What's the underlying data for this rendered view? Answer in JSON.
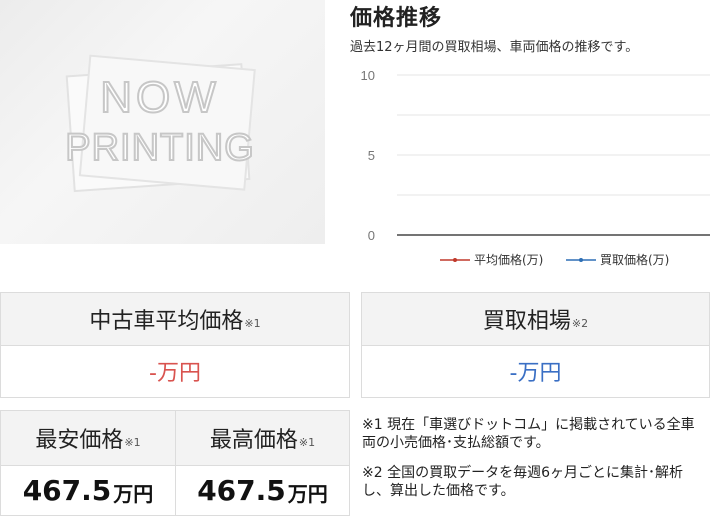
{
  "placeholder": {
    "line1": "NOW",
    "line2": "PRINTING"
  },
  "trend": {
    "title": "価格推移",
    "subtitle": "過去12ヶ月間の買取相場、車両価格の推移です。"
  },
  "chart_data": {
    "type": "line",
    "ylim": [
      0,
      10
    ],
    "yticks": [
      "10",
      "5",
      "0"
    ],
    "series": [
      {
        "name": "平均価格(万)",
        "color": "#c0392b",
        "values": []
      },
      {
        "name": "買取価格(万)",
        "color": "#2e6fb5",
        "values": []
      }
    ],
    "grid": true,
    "legend": "bottom"
  },
  "avg": {
    "label": "中古車平均価格",
    "note": "※1",
    "value": "-万円",
    "color": "#d9534f"
  },
  "buy": {
    "label": "買取相場",
    "note": "※2",
    "value": "-万円",
    "color": "#3a6fc4"
  },
  "min": {
    "label": "最安価格",
    "note": "※1",
    "value": "467.5",
    "unit": "万円"
  },
  "max": {
    "label": "最高価格",
    "note": "※1",
    "value": "467.5",
    "unit": "万円"
  },
  "footnotes": [
    "※1 現在「車選びドットコム」に掲載されている全車両の小売価格･支払総額です。",
    "※2 全国の買取データを毎週6ヶ月ごとに集計･解析し、算出した価格です。"
  ]
}
